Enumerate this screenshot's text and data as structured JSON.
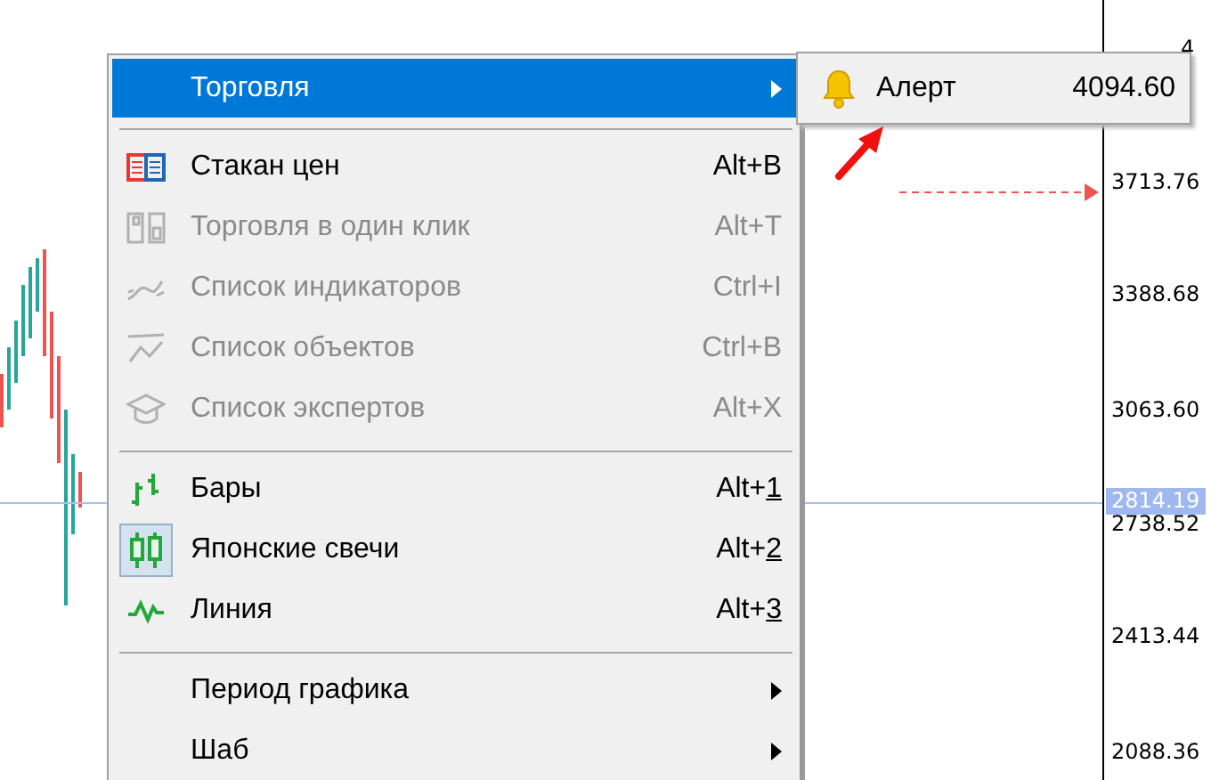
{
  "price_axis": {
    "labels": [
      {
        "text": "4"
      },
      {
        "text": "3713.76"
      },
      {
        "text": "3388.68"
      },
      {
        "text": "3063.60"
      },
      {
        "text": "2738.52"
      },
      {
        "text": "2413.44"
      },
      {
        "text": "2088.36"
      }
    ],
    "current_price": "2814.19"
  },
  "menu": {
    "groups": [
      [
        {
          "label": "Торговля",
          "kind": "plain",
          "disabled": false,
          "selected": true,
          "checked": false,
          "submenu": true
        }
      ],
      [
        {
          "label": "Стакан цен",
          "shortcut": "Alt+B",
          "kind": "depth",
          "disabled": false,
          "selected": false,
          "checked": false,
          "submenu": false
        },
        {
          "label": "Торговля в один клик",
          "shortcut": "Alt+T",
          "kind": "oneclick",
          "disabled": true,
          "selected": false,
          "checked": false,
          "submenu": false
        },
        {
          "label": "Список индикаторов",
          "shortcut": "Ctrl+I",
          "kind": "indicators",
          "disabled": true,
          "selected": false,
          "checked": false,
          "submenu": false
        },
        {
          "label": "Список объектов",
          "shortcut": "Ctrl+B",
          "kind": "objects",
          "disabled": true,
          "selected": false,
          "checked": false,
          "submenu": false
        },
        {
          "label": "Список экспертов",
          "shortcut": "Alt+X",
          "kind": "experts",
          "disabled": true,
          "selected": false,
          "checked": false,
          "submenu": false
        }
      ],
      [
        {
          "label": "Бары",
          "shortcut": "Alt+",
          "accel": "1",
          "kind": "bars",
          "disabled": false,
          "selected": false,
          "checked": false,
          "submenu": false
        },
        {
          "label": "Японские свечи",
          "shortcut": "Alt+",
          "accel": "2",
          "kind": "candles",
          "disabled": false,
          "selected": false,
          "checked": true,
          "submenu": false
        },
        {
          "label": "Линия",
          "shortcut": "Alt+",
          "accel": "3",
          "kind": "line",
          "disabled": false,
          "selected": false,
          "checked": false,
          "submenu": false
        }
      ],
      [
        {
          "label": "Период графика",
          "kind": "plain",
          "disabled": false,
          "selected": false,
          "checked": false,
          "submenu": true
        },
        {
          "label": "Шаб",
          "kind": "plain",
          "disabled": false,
          "selected": false,
          "checked": false,
          "submenu": true
        }
      ]
    ]
  },
  "submenu": {
    "label": "Алерт",
    "value": "4094.60"
  }
}
